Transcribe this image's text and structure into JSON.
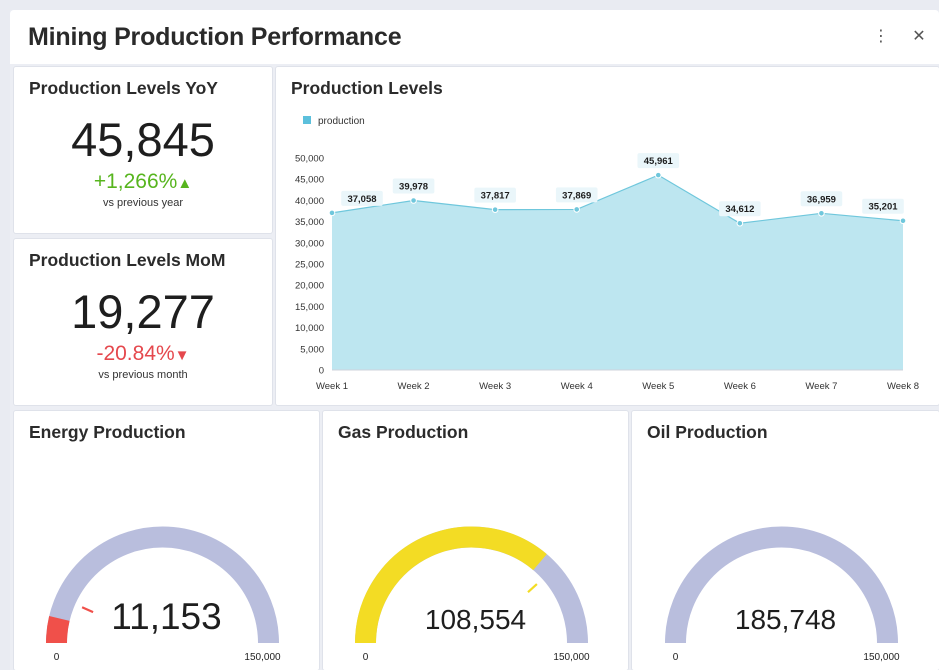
{
  "header": {
    "title": "Mining Production Performance",
    "more_icon": "more-vertical-icon",
    "close_icon": "close-icon"
  },
  "kpi_yoy": {
    "title": "Production Levels YoY",
    "value": "45,845",
    "delta": "+1,266%",
    "delta_arrow": "▲",
    "subtitle": "vs previous year"
  },
  "kpi_mom": {
    "title": "Production Levels MoM",
    "value": "19,277",
    "delta": "-20.84%",
    "delta_arrow": "▼",
    "subtitle": "vs previous month"
  },
  "colors": {
    "area_fill": "#bde6f0",
    "area_line": "#6fc7dc",
    "legend_swatch": "#5cc0dc",
    "gauge_track": "#b9bedd",
    "gauge_energy": "#f0504a",
    "gauge_gas": "#f3dc24",
    "up": "#57b51e",
    "down": "#e5484d"
  },
  "chart_data": {
    "type": "area",
    "title": "Production Levels",
    "legend": [
      "production"
    ],
    "categories": [
      "Week 1",
      "Week 2",
      "Week 3",
      "Week 4",
      "Week 5",
      "Week 6",
      "Week 7",
      "Week 8"
    ],
    "series": [
      {
        "name": "production",
        "values": [
          37058,
          39978,
          37817,
          37869,
          45961,
          34612,
          36959,
          35201
        ]
      }
    ],
    "data_labels": [
      "37,058",
      "39,978",
      "37,817",
      "37,869",
      "45,961",
      "34,612",
      "36,959",
      "35,201"
    ],
    "ylim": [
      0,
      50000
    ],
    "yticks": [
      0,
      5000,
      10000,
      15000,
      20000,
      25000,
      30000,
      35000,
      40000,
      45000,
      50000
    ],
    "ytick_labels": [
      "0",
      "5,000",
      "10,000",
      "15,000",
      "20,000",
      "25,000",
      "30,000",
      "35,000",
      "40,000",
      "45,000",
      "50,000"
    ],
    "legend_position": "top-left",
    "grid": false
  },
  "gauges": [
    {
      "title": "Energy Production",
      "value": 11153,
      "value_label": "11,153",
      "min": 0,
      "max": 150000,
      "min_label": "0",
      "max_label": "150,000",
      "target": 20000,
      "color_key": "gauge_energy"
    },
    {
      "title": "Gas Production",
      "value": 108554,
      "value_label": "108,554",
      "min": 0,
      "max": 150000,
      "min_label": "0",
      "max_label": "150,000",
      "target": 115000,
      "color_key": "gauge_gas"
    },
    {
      "title": "Oil Production",
      "value": 185748,
      "value_label": "185,748",
      "min": 0,
      "max": 150000,
      "min_label": "0",
      "max_label": "150,000",
      "target": null,
      "color_key": "gauge_track"
    }
  ]
}
